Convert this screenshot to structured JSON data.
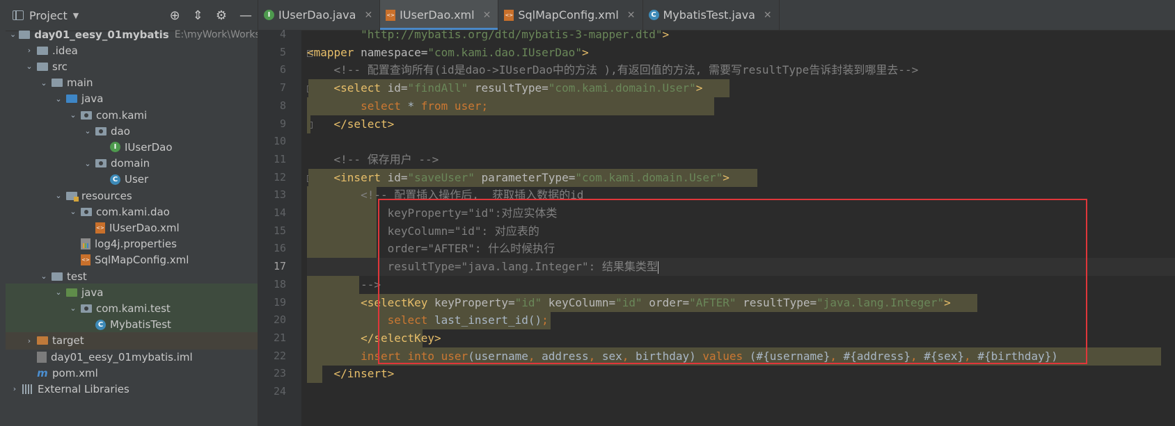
{
  "project_panel": {
    "title": "Project",
    "tree": [
      {
        "label": "day01_eesy_01mybatis",
        "hint": "E:\\myWork\\Works",
        "icon": "module-folder-icon",
        "depth": 0,
        "arrow": "v",
        "bold": true
      },
      {
        "label": ".idea",
        "icon": "folder-icon",
        "depth": 1,
        "arrow": ">"
      },
      {
        "label": "src",
        "icon": "folder-icon",
        "depth": 1,
        "arrow": "v"
      },
      {
        "label": "main",
        "icon": "folder-icon",
        "depth": 2,
        "arrow": "v"
      },
      {
        "label": "java",
        "icon": "source-folder-icon",
        "depth": 3,
        "arrow": "v"
      },
      {
        "label": "com.kami",
        "icon": "package-icon",
        "depth": 4,
        "arrow": "v"
      },
      {
        "label": "dao",
        "icon": "package-icon",
        "depth": 5,
        "arrow": "v"
      },
      {
        "label": "IUserDao",
        "icon": "interface-icon",
        "depth": 6,
        "arrow": ""
      },
      {
        "label": "domain",
        "icon": "package-icon",
        "depth": 5,
        "arrow": "v"
      },
      {
        "label": "User",
        "icon": "class-icon",
        "depth": 6,
        "arrow": ""
      },
      {
        "label": "resources",
        "icon": "resources-folder-icon",
        "depth": 3,
        "arrow": "v"
      },
      {
        "label": "com.kami.dao",
        "icon": "package-icon",
        "depth": 4,
        "arrow": "v"
      },
      {
        "label": "IUserDao.xml",
        "icon": "xml-file-icon",
        "depth": 5,
        "arrow": ""
      },
      {
        "label": "log4j.properties",
        "icon": "properties-file-icon",
        "depth": 4,
        "arrow": ""
      },
      {
        "label": "SqlMapConfig.xml",
        "icon": "xml-file-icon",
        "depth": 4,
        "arrow": ""
      },
      {
        "label": "test",
        "icon": "folder-icon",
        "depth": 2,
        "arrow": "v"
      },
      {
        "label": "java",
        "icon": "test-source-folder-icon",
        "depth": 3,
        "arrow": "v"
      },
      {
        "label": "com.kami.test",
        "icon": "package-icon",
        "depth": 4,
        "arrow": "v"
      },
      {
        "label": "MybatisTest",
        "icon": "class-icon",
        "depth": 5,
        "arrow": ""
      },
      {
        "label": "target",
        "icon": "excluded-folder-icon",
        "depth": 1,
        "arrow": ">"
      },
      {
        "label": "day01_eesy_01mybatis.iml",
        "icon": "iml-file-icon",
        "depth": 1,
        "arrow": ""
      },
      {
        "label": "pom.xml",
        "icon": "maven-icon",
        "depth": 1,
        "arrow": ""
      },
      {
        "label": "External Libraries",
        "icon": "libraries-icon",
        "depth": 0,
        "arrow": ">"
      }
    ]
  },
  "tabs": [
    {
      "label": "IUserDao.java",
      "icon": "interface-icon",
      "active": false
    },
    {
      "label": "IUserDao.xml",
      "icon": "xml-file-icon",
      "active": true
    },
    {
      "label": "SqlMapConfig.xml",
      "icon": "xml-file-icon",
      "active": false
    },
    {
      "label": "MybatisTest.java",
      "icon": "class-icon",
      "active": false
    }
  ],
  "editor": {
    "current_line": 17,
    "lines": [
      {
        "n": "4",
        "segs": [
          [
            "t-str",
            "        \"http://mybatis.org/dtd/mybatis-3-mapper.dtd\""
          ],
          [
            "t-tag",
            ">"
          ]
        ]
      },
      {
        "n": "5",
        "segs": [
          [
            "t-tag",
            "<mapper "
          ],
          [
            "t-attr",
            "namespace="
          ],
          [
            "t-str",
            "\"com.kami.dao.IUserDao\""
          ],
          [
            "t-tag",
            ">"
          ]
        ]
      },
      {
        "n": "6",
        "segs": [
          [
            "t-cmt",
            "    <!-- 配置查询所有(id是dao->IUserDao中的方法 ),有返回值的方法, 需要写resultType告诉封装到哪里去-->"
          ]
        ]
      },
      {
        "n": "7",
        "segs": [
          [
            "t-tag",
            "    <select "
          ],
          [
            "t-attr",
            "id="
          ],
          [
            "t-str",
            "\"findAll\" "
          ],
          [
            "t-attr",
            "resultType="
          ],
          [
            "t-str",
            "\"com.kami.domain.User\""
          ],
          [
            "t-tag",
            ">"
          ]
        ]
      },
      {
        "n": "8",
        "segs": [
          [
            "t-kw",
            "        select "
          ],
          [
            "t-plain",
            "* "
          ],
          [
            "t-kw",
            "from user;"
          ]
        ]
      },
      {
        "n": "9",
        "segs": [
          [
            "t-tag",
            "    </select>"
          ]
        ]
      },
      {
        "n": "10",
        "segs": []
      },
      {
        "n": "11",
        "segs": [
          [
            "t-cmt",
            "    <!-- 保存用户 -->"
          ]
        ]
      },
      {
        "n": "12",
        "segs": [
          [
            "t-tag",
            "    <insert "
          ],
          [
            "t-attr",
            "id="
          ],
          [
            "t-str",
            "\"saveUser\" "
          ],
          [
            "t-attr",
            "parameterType="
          ],
          [
            "t-str",
            "\"com.kami.domain.User\""
          ],
          [
            "t-tag",
            ">"
          ]
        ]
      },
      {
        "n": "13",
        "segs": [
          [
            "t-cmt",
            "        <!-- 配置插入操作后,  获取插入数据的id"
          ]
        ]
      },
      {
        "n": "14",
        "segs": [
          [
            "t-cmt",
            "            keyProperty=\"id\":对应实体类"
          ]
        ]
      },
      {
        "n": "15",
        "segs": [
          [
            "t-cmt",
            "            keyColumn=\"id\": 对应表的"
          ]
        ]
      },
      {
        "n": "16",
        "segs": [
          [
            "t-cmt",
            "            order=\"AFTER\": 什么时候执行"
          ]
        ]
      },
      {
        "n": "17",
        "segs": [
          [
            "t-cmt",
            "            resultType=\"java.lang.Integer\": 结果集类型"
          ]
        ]
      },
      {
        "n": "18",
        "segs": [
          [
            "t-cmt",
            "        -->"
          ]
        ]
      },
      {
        "n": "19",
        "segs": [
          [
            "t-tag",
            "        <selectKey "
          ],
          [
            "t-attr",
            "keyProperty="
          ],
          [
            "t-str",
            "\"id\" "
          ],
          [
            "t-attr",
            "keyColumn="
          ],
          [
            "t-str",
            "\"id\" "
          ],
          [
            "t-attr",
            "order="
          ],
          [
            "t-str",
            "\"AFTER\" "
          ],
          [
            "t-attr",
            "resultType="
          ],
          [
            "t-str",
            "\"java.lang.Integer\""
          ],
          [
            "t-tag",
            ">"
          ]
        ]
      },
      {
        "n": "20",
        "segs": [
          [
            "t-kw",
            "            select "
          ],
          [
            "t-plain",
            "last_insert_id"
          ],
          [
            "t-plain",
            "()"
          ],
          [
            "t-kw",
            ";"
          ]
        ]
      },
      {
        "n": "21",
        "segs": [
          [
            "t-tag",
            "        </selectKey>"
          ]
        ]
      },
      {
        "n": "22",
        "segs": [
          [
            "t-kw",
            "        insert into "
          ],
          [
            "t-kw",
            "user"
          ],
          [
            "t-plain",
            "(username"
          ],
          [
            "t-kw",
            ", "
          ],
          [
            "t-plain",
            "address"
          ],
          [
            "t-kw",
            ", "
          ],
          [
            "t-plain",
            "sex"
          ],
          [
            "t-kw",
            ", "
          ],
          [
            "t-plain",
            "birthday) "
          ],
          [
            "t-kw",
            "values "
          ],
          [
            "t-plain",
            "(#{username}"
          ],
          [
            "t-kw",
            ", "
          ],
          [
            "t-plain",
            "#{address}"
          ],
          [
            "t-kw",
            ", "
          ],
          [
            "t-plain",
            "#{sex}"
          ],
          [
            "t-kw",
            ", "
          ],
          [
            "t-plain",
            "#{birthday})"
          ]
        ]
      },
      {
        "n": "23",
        "segs": [
          [
            "t-tag",
            "    </insert>"
          ]
        ]
      },
      {
        "n": "24",
        "segs": []
      }
    ]
  },
  "colors": {
    "highlight_box": "#e0363a",
    "accent": "#4a88c7"
  }
}
